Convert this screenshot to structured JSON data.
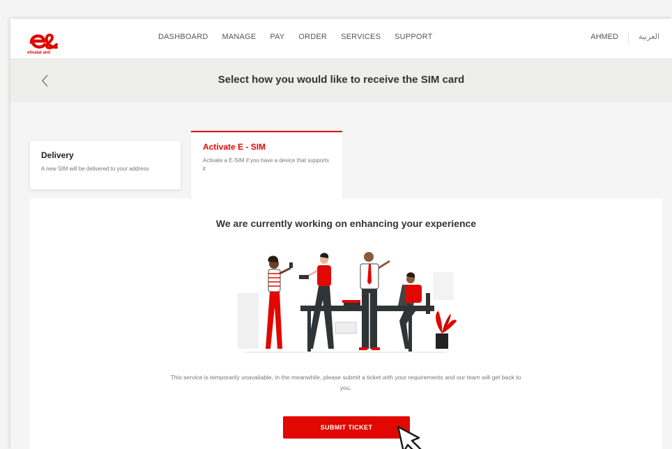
{
  "header": {
    "logo_text": "etisalat and",
    "nav": [
      "DASHBOARD",
      "MANAGE",
      "PAY",
      "ORDER",
      "SERVICES",
      "SUPPORT"
    ],
    "user": "AHMED",
    "language": "العربية"
  },
  "titlebar": {
    "title": "Select how you would like to receive the SIM card",
    "back_icon": "chevron-left-icon"
  },
  "tabs": [
    {
      "title": "Delivery",
      "description": "A new SIM will be delivered to your address",
      "selected": false
    },
    {
      "title": "Activate E - SIM",
      "description": "Activate a E-SIM if you have a device that supports it",
      "selected": true
    }
  ],
  "main": {
    "heading": "We are currently working on enhancing your experience",
    "notice": "This service is temporarily unavailable, in the meanwhile, please submit a ticket with your requirements and our team will get back to you.",
    "submit_label": "SUBMIT TICKET"
  },
  "colors": {
    "brand_red": "#e00800",
    "page_bg": "#f5f5f5",
    "titlebar_bg": "#eeeeea"
  }
}
